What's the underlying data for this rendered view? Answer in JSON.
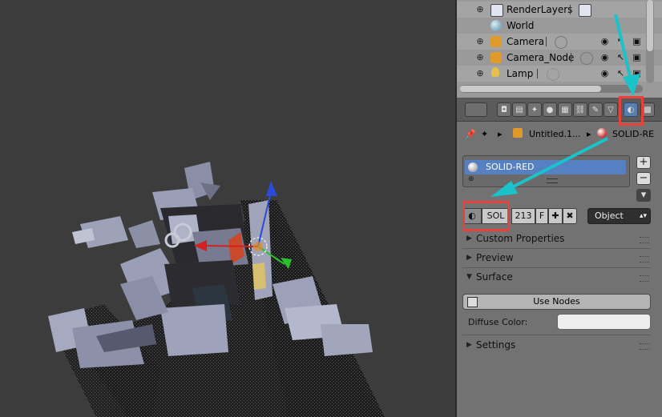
{
  "outliner": {
    "items": [
      {
        "label": "RenderLayers",
        "icon": "render-layers-icon"
      },
      {
        "label": "World",
        "icon": "world-icon"
      },
      {
        "label": "Camera",
        "icon": "camera-object-icon"
      },
      {
        "label": "Camera_Node",
        "icon": "camera-object-icon"
      },
      {
        "label": "Lamp",
        "icon": "lamp-object-icon"
      }
    ]
  },
  "properties": {
    "context_tabs": [
      "render-icon",
      "render-layers-icon",
      "scene-icon",
      "world-icon",
      "object-icon",
      "constraints-icon",
      "modifiers-icon",
      "data-icon",
      "material-icon",
      "texture-icon"
    ],
    "active_tab": "material-icon",
    "breadcrumb": {
      "object": "Untitled.1...",
      "material": "SOLID-RE"
    },
    "material_slots": [
      {
        "name": "SOLID-RED"
      }
    ],
    "material_block": {
      "name": "SOL",
      "users": "213",
      "fake": "F"
    },
    "link_dropdown": "Object",
    "panels": {
      "custom_properties": "Custom Properties",
      "preview": "Preview",
      "surface": "Surface",
      "settings": "Settings"
    },
    "surface": {
      "use_nodes_label": "Use Nodes",
      "diffuse_label": "Diffuse Color:",
      "diffuse_color": "#eeeeee"
    }
  },
  "colors": {
    "annotation_box": "#e8413c",
    "annotation_arrow": "#19c3c9",
    "selection_blue": "#5680c2"
  }
}
